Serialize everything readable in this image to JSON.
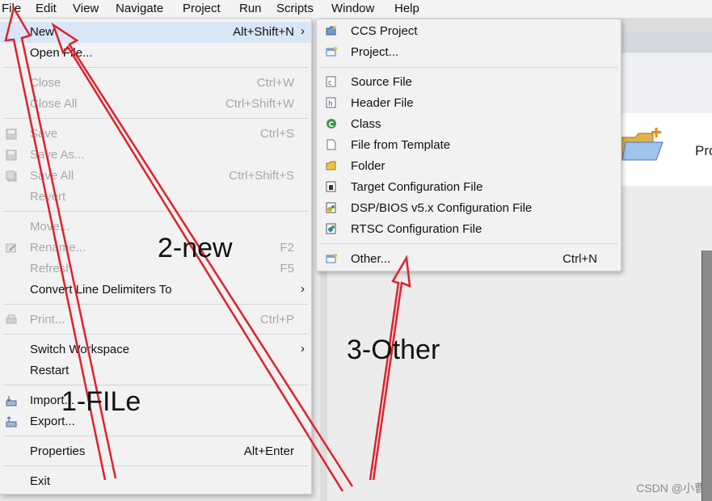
{
  "menubar": {
    "file": "File",
    "edit": "Edit",
    "view": "View",
    "navigate": "Navigate",
    "project": "Project",
    "run": "Run",
    "scripts": "Scripts",
    "window": "Window",
    "help": "Help"
  },
  "file_menu": {
    "new": {
      "label": "New",
      "shortcut": "Alt+Shift+N"
    },
    "open_file": {
      "label": "Open File..."
    },
    "close": {
      "label": "Close",
      "shortcut": "Ctrl+W"
    },
    "close_all": {
      "label": "Close All",
      "shortcut": "Ctrl+Shift+W"
    },
    "save": {
      "label": "Save",
      "shortcut": "Ctrl+S"
    },
    "save_as": {
      "label": "Save As..."
    },
    "save_all": {
      "label": "Save All",
      "shortcut": "Ctrl+Shift+S"
    },
    "revert": {
      "label": "Revert"
    },
    "move": {
      "label": "Move..."
    },
    "rename": {
      "label": "Rename...",
      "shortcut": "F2"
    },
    "refresh": {
      "label": "Refresh",
      "shortcut": "F5"
    },
    "convert": {
      "label": "Convert Line Delimiters To"
    },
    "print": {
      "label": "Print...",
      "shortcut": "Ctrl+P"
    },
    "switch_workspace": {
      "label": "Switch Workspace"
    },
    "restart": {
      "label": "Restart"
    },
    "import": {
      "label": "Import..."
    },
    "export": {
      "label": "Export..."
    },
    "properties": {
      "label": "Properties",
      "shortcut": "Alt+Enter"
    },
    "exit": {
      "label": "Exit"
    }
  },
  "new_submenu": {
    "ccs_project": "CCS Project",
    "project": "Project...",
    "source_file": "Source File",
    "header_file": "Header File",
    "class": "Class",
    "file_from_template": "File from Template",
    "folder": "Folder",
    "target_config": "Target Configuration File",
    "dsp_bios": "DSP/BIOS v5.x Configuration File",
    "rtsc": "RTSC Configuration File",
    "other": {
      "label": "Other...",
      "shortcut": "Ctrl+N"
    }
  },
  "background": {
    "banner_text": "Pro"
  },
  "annotations": {
    "step1": "1-FILe",
    "step2": "2-new",
    "step3": "3-Other"
  },
  "watermark": "CSDN @小曹",
  "colors": {
    "arrow": "#e0212b",
    "hover": "#d9e6f6",
    "disabled": "#a8a8a8"
  }
}
